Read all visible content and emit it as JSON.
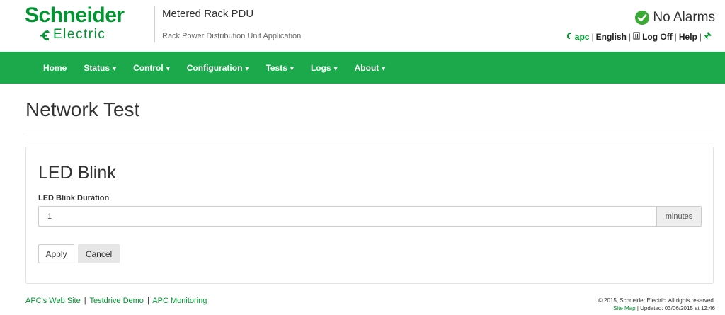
{
  "brand": {
    "logo_top": "Schneider",
    "logo_bottom": "Electric"
  },
  "header": {
    "app_title": "Metered Rack PDU",
    "app_subtitle": "Rack Power Distribution Unit Application",
    "alarm_status": "No Alarms",
    "links": {
      "apc": "apc",
      "language": "English",
      "logoff": "Log Off",
      "help": "Help"
    }
  },
  "nav": [
    {
      "label": "Home",
      "dropdown": false
    },
    {
      "label": "Status",
      "dropdown": true
    },
    {
      "label": "Control",
      "dropdown": true
    },
    {
      "label": "Configuration",
      "dropdown": true
    },
    {
      "label": "Tests",
      "dropdown": true
    },
    {
      "label": "Logs",
      "dropdown": true
    },
    {
      "label": "About",
      "dropdown": true
    }
  ],
  "page": {
    "title": "Network Test",
    "panel": {
      "title": "LED Blink",
      "field_label": "LED Blink Duration",
      "field_value": "1",
      "field_unit": "minutes",
      "apply_label": "Apply",
      "cancel_label": "Cancel"
    }
  },
  "footer": {
    "links": [
      "APC's Web Site",
      "Testdrive Demo",
      "APC Monitoring"
    ],
    "copyright": "© 2015, Schneider Electric. All rights reserved.",
    "site_map": "Site Map",
    "updated": "| Updated: 03/06/2015 at 12:46"
  },
  "colors": {
    "brand_green": "#009530",
    "nav_green": "#1ba94b",
    "alarm_ok": "#3aaa35"
  },
  "icons": {
    "alarm": "check-circle-icon",
    "apc": "apc-icon",
    "logoff": "logoff-icon",
    "help": "pin-icon",
    "logo": "electric-mark-icon"
  }
}
